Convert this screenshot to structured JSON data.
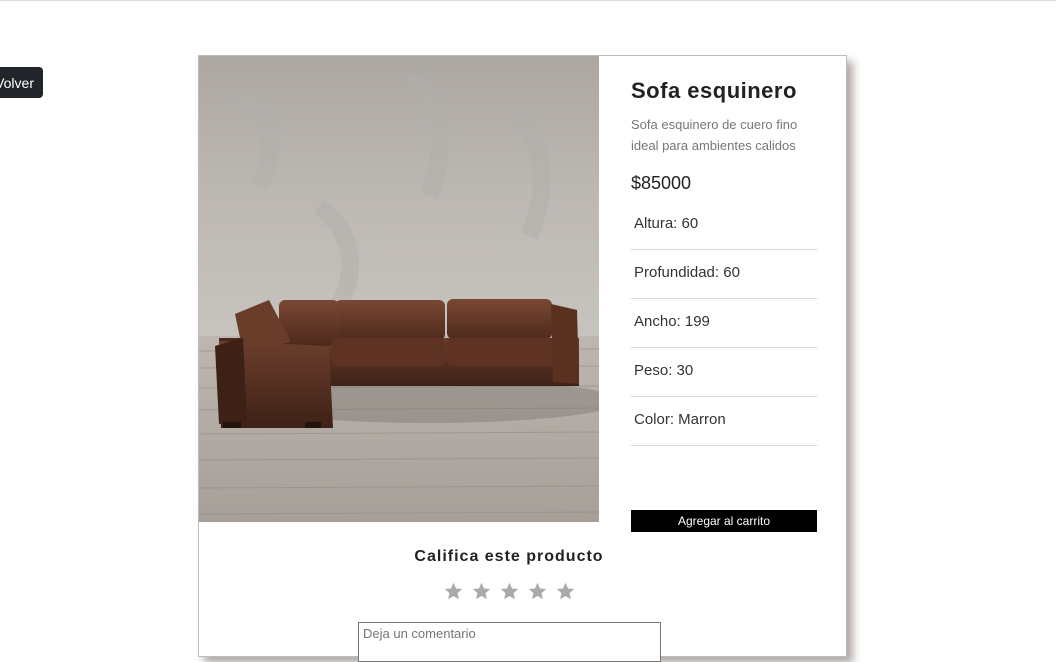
{
  "nav": {
    "back_label": "Volver"
  },
  "product": {
    "name": "Sofa esquinero",
    "description": "Sofa esquinero de cuero fino ideal para ambientes calidos",
    "price": "$85000",
    "specs": [
      "Altura: 60",
      "Profundidad: 60",
      "Ancho: 199",
      "Peso: 30",
      "Color: Marron"
    ],
    "image_subject": "brown leather sectional sofa on wood floor",
    "add_to_cart_label": "Agregar al carrito"
  },
  "rating": {
    "title": "Califica este producto",
    "max_stars": 5,
    "selected": 0,
    "star_color": "#aaaaaa"
  },
  "comment": {
    "placeholder": "Deja un comentario"
  },
  "colors": {
    "button_dark": "#212529",
    "cart_button": "#000000"
  }
}
